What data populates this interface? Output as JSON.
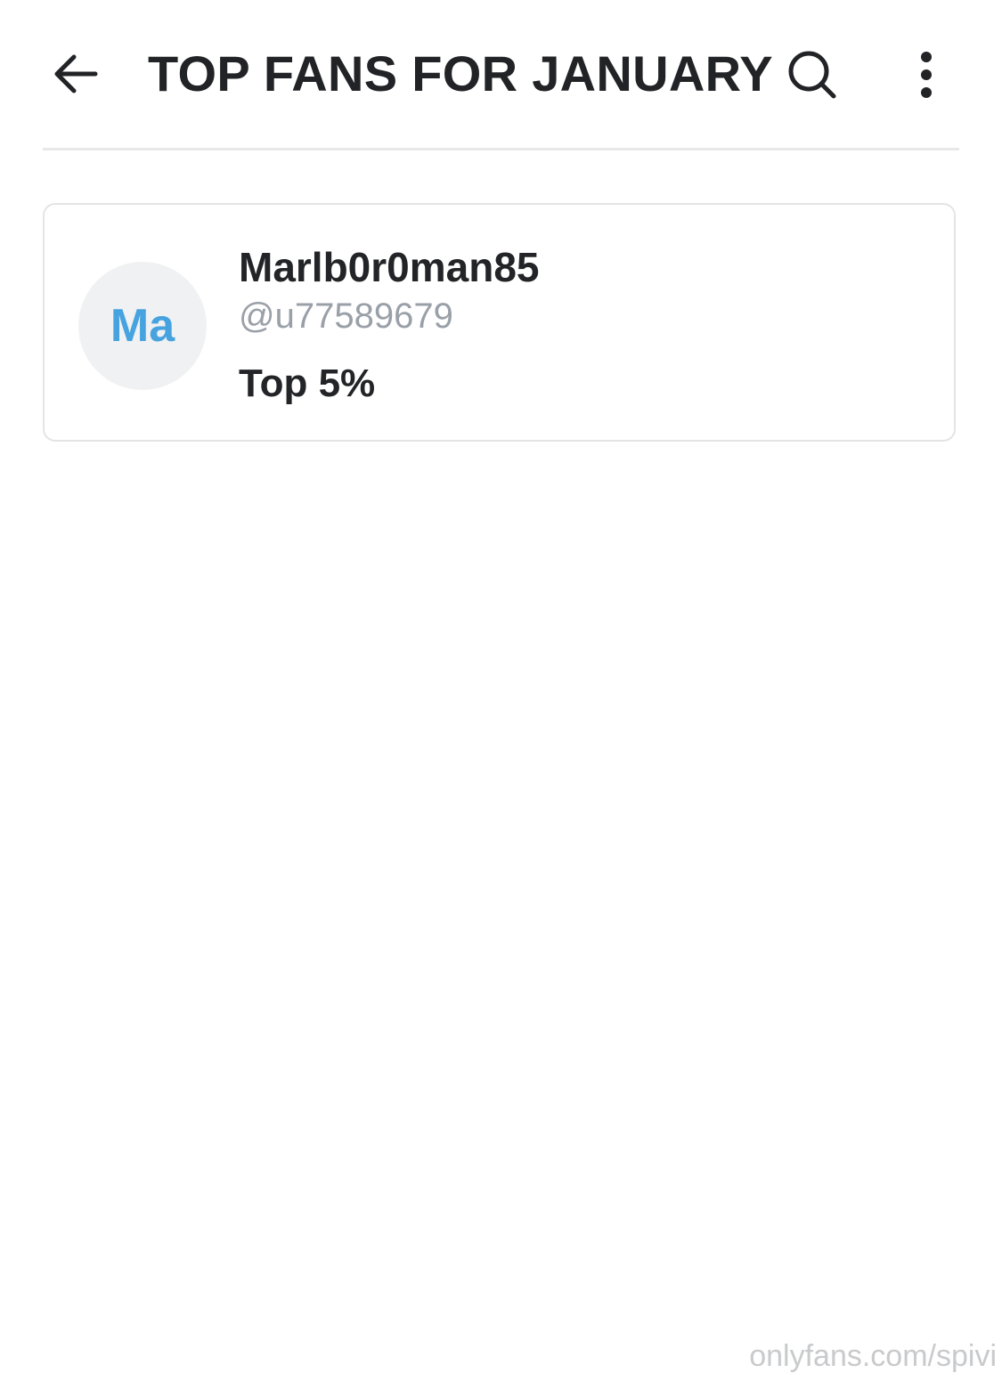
{
  "header": {
    "title": "TOP FANS FOR JANUARY",
    "back_icon": "arrow-left-icon",
    "search_icon": "search-icon",
    "more_icon": "more-vertical-icon"
  },
  "fans": [
    {
      "avatar_initials": "Ma",
      "name": "Marlb0r0man85",
      "handle": "@u77589679",
      "rank": "Top 5%"
    }
  ],
  "watermark": "onlyfans.com/spivi",
  "colors": {
    "avatar_text": "#46a3e0",
    "avatar_bg": "#f0f1f2",
    "handle_text": "#9aa0a8",
    "divider": "#e7e8ea"
  }
}
